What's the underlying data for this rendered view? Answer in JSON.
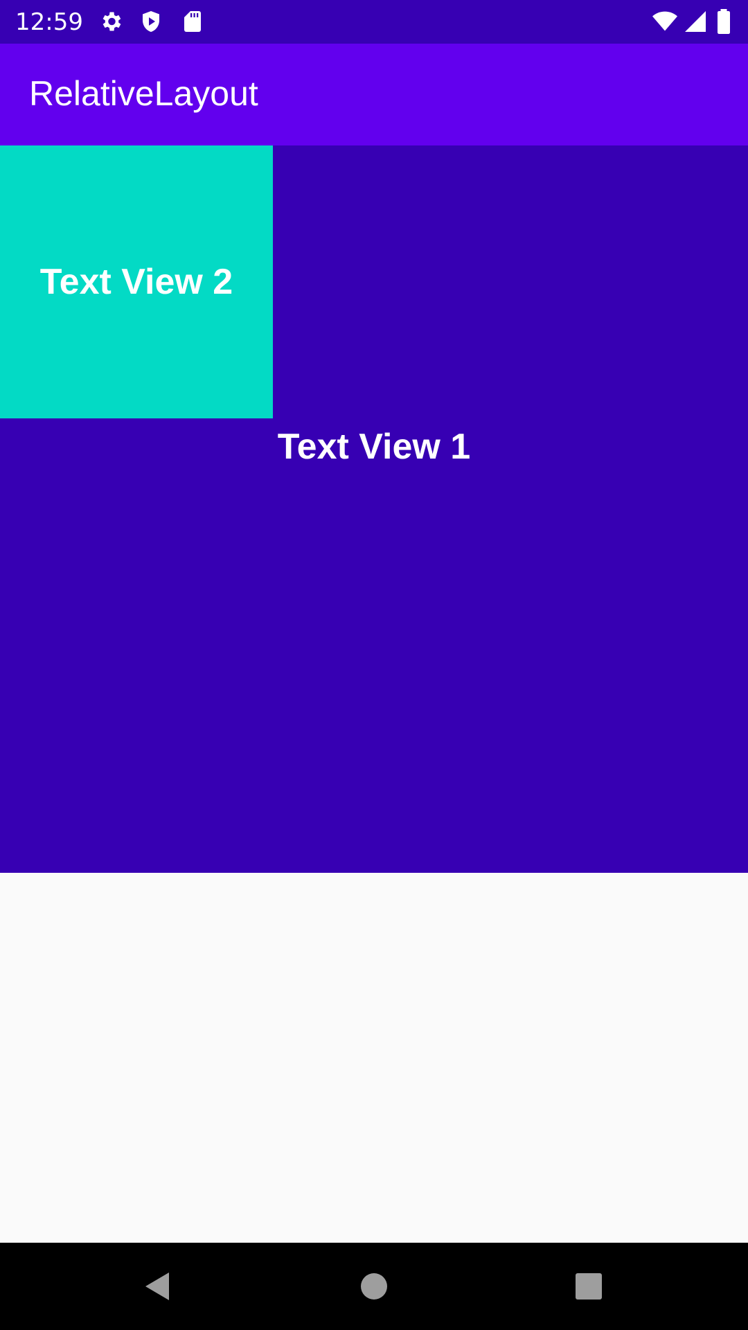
{
  "status_bar": {
    "time": "12:59",
    "icons": [
      "gear-icon",
      "shield-play-icon",
      "sd-card-icon",
      "wifi-icon",
      "signal-icon",
      "battery-icon"
    ],
    "background": "#3700b3"
  },
  "app_bar": {
    "title": "RelativeLayout",
    "background": "#6200ee"
  },
  "layout": {
    "background": "#3700b3",
    "text_view_2": {
      "label": "Text View 2",
      "background": "#03dac5"
    },
    "text_view_1": {
      "label": "Text View 1"
    }
  },
  "nav_bar": {
    "buttons": [
      "back-icon",
      "home-icon",
      "recents-icon"
    ],
    "background": "#000000"
  }
}
